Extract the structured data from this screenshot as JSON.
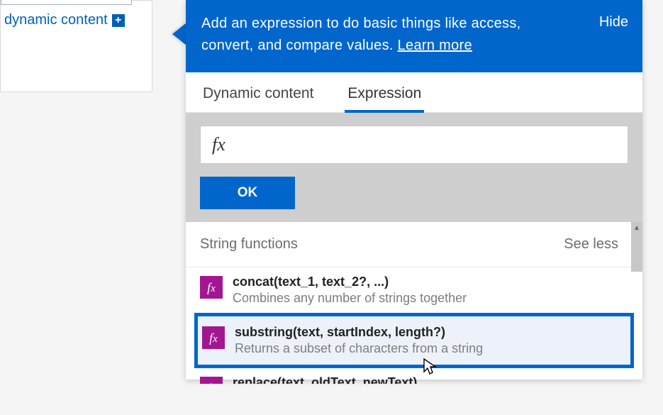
{
  "left": {
    "dynamic_label": "dynamic content",
    "add_glyph": "+"
  },
  "header": {
    "description": "Add an expression to do basic things like access, convert, and compare values.",
    "learn_label": "Learn more",
    "hide_label": "Hide"
  },
  "tabs": {
    "dynamic": "Dynamic content",
    "expression": "Expression"
  },
  "input": {
    "fx_glyph": "fx",
    "ok_label": "OK"
  },
  "section": {
    "title": "String functions",
    "see_less": "See less"
  },
  "functions": [
    {
      "signature": "concat(text_1, text_2?, ...)",
      "description": "Combines any number of strings together"
    },
    {
      "signature": "substring(text, startIndex, length?)",
      "description": "Returns a subset of characters from a string"
    },
    {
      "signature": "replace(text, oldText, newText)",
      "description": ""
    }
  ]
}
